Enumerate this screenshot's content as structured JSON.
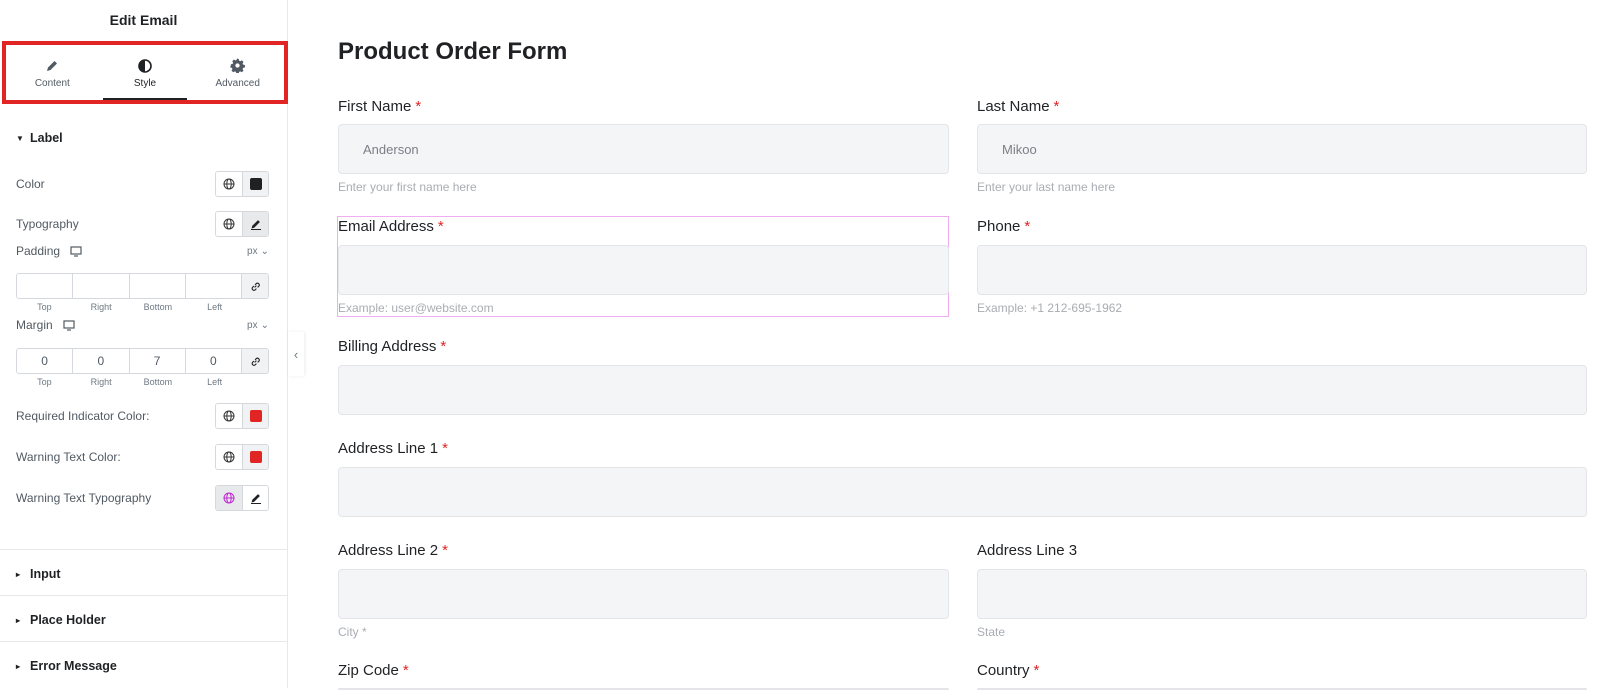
{
  "panel": {
    "title": "Edit Email",
    "tabs": [
      {
        "label": "Content",
        "icon": "pencil-icon"
      },
      {
        "label": "Style",
        "icon": "contrast-icon"
      },
      {
        "label": "Advanced",
        "icon": "gear-icon"
      }
    ],
    "active_tab": "Style",
    "label_section": {
      "title": "Label",
      "color_label": "Color",
      "color_value": "#1f2124",
      "typography_label": "Typography",
      "padding_label": "Padding",
      "padding_unit": "px",
      "padding_values": [
        "",
        "",
        "",
        ""
      ],
      "margin_label": "Margin",
      "margin_unit": "px",
      "margin_values": [
        "0",
        "0",
        "7",
        "0"
      ],
      "sides": [
        "Top",
        "Right",
        "Bottom",
        "Left"
      ],
      "required_label": "Required Indicator Color:",
      "required_color": "#e12424",
      "warning_color_label": "Warning Text Color:",
      "warning_color": "#e12424",
      "warning_typo_label": "Warning Text Typography"
    },
    "sections": [
      "Input",
      "Place Holder",
      "Error Message"
    ]
  },
  "form": {
    "title": "Product Order Form",
    "required_mark": "*",
    "fields": {
      "first_name": {
        "label": "First Name",
        "value": "Anderson",
        "help": "Enter your first name here"
      },
      "last_name": {
        "label": "Last Name",
        "value": "Mikoo",
        "help": "Enter your last name here"
      },
      "email": {
        "label": "Email Address",
        "value": "",
        "help": "Example: user@website.com"
      },
      "phone": {
        "label": "Phone",
        "value": "",
        "help": "Example: +1 212-695-1962"
      },
      "billing": {
        "label": "Billing Address"
      },
      "address1": {
        "label": "Address Line 1"
      },
      "address2": {
        "label": "Address Line 2",
        "help": "City *"
      },
      "address3": {
        "label": "Address Line 3",
        "help": "State"
      },
      "zip": {
        "label": "Zip Code"
      },
      "country": {
        "label": "Country"
      }
    }
  }
}
